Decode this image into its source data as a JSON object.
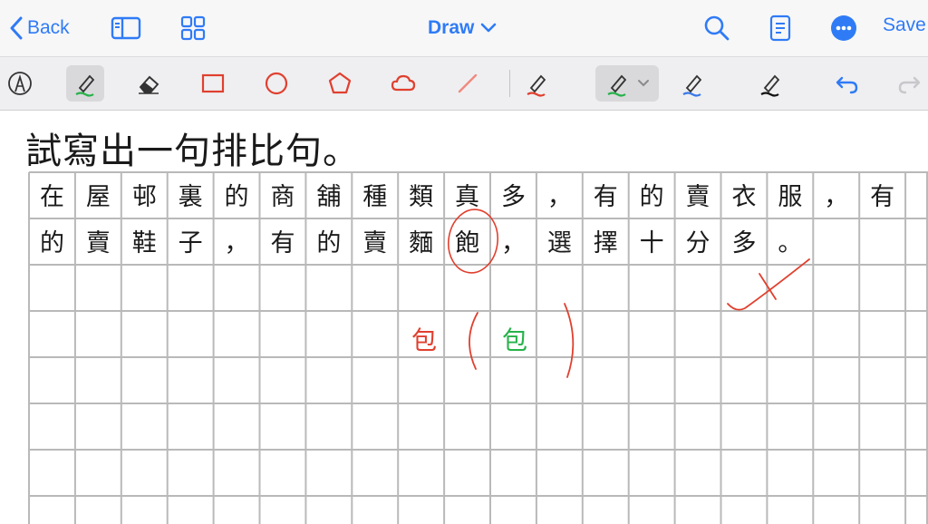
{
  "nav": {
    "back_label": "Back",
    "title": "Draw",
    "save_label": "Save",
    "accent_color": "#2f7bf6"
  },
  "toolbar": {
    "tools": [
      "lasso",
      "highlighter",
      "eraser",
      "rectangle",
      "circle",
      "pentagon",
      "cloud",
      "line",
      "pen-red",
      "pen-green",
      "pen-blue",
      "pen-black",
      "undo",
      "redo"
    ],
    "selected_tool": "highlighter",
    "selected_pen": "pen-green"
  },
  "document": {
    "heading": "試寫出一句排比句。",
    "row1": [
      "在",
      "屋",
      "邨",
      "裏",
      "的",
      "商",
      "舖",
      "種",
      "類",
      "真",
      "多",
      "，",
      "有",
      "的",
      "賣",
      "衣",
      "服",
      "，",
      "有"
    ],
    "row2": [
      "的",
      "賣",
      "鞋",
      "子",
      "，",
      "有",
      "的",
      "賣",
      "麵",
      "飽",
      "，",
      "選",
      "擇",
      "十",
      "分",
      "多",
      "。"
    ],
    "correction_wrong": "包",
    "correction_right": "包",
    "colors": {
      "ink": "#1a1a1a",
      "red": "#e0402f",
      "green": "#27b24a",
      "grid": "#b9b9b9"
    }
  }
}
